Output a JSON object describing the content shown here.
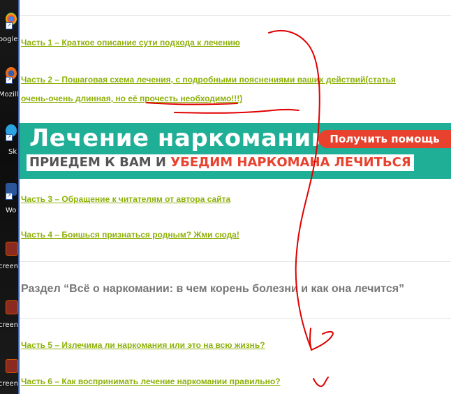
{
  "desktop": {
    "icons": [
      {
        "label": "oogle",
        "icon": "chrome-icon",
        "color": "#e8b40a"
      },
      {
        "label": "Mozilla",
        "icon": "firefox-icon",
        "color": "#e66a1a"
      },
      {
        "label": "Sk",
        "icon": "skype-icon",
        "color": "#2aa3e0"
      },
      {
        "label": "Wo",
        "icon": "word-icon",
        "color": "#2b579a"
      },
      {
        "label": "creen",
        "icon": "screenshot-file-icon",
        "color": "#c0392b"
      },
      {
        "label": "creen",
        "icon": "screenshot-file-icon",
        "color": "#c0392b"
      },
      {
        "label": "creen",
        "icon": "screenshot-file-icon",
        "color": "#c0392b"
      }
    ]
  },
  "links": {
    "part1": "Часть 1 – Краткое описание сути подхода к лечению",
    "part2_line1": "Часть 2 – Пошаговая схема лечения, с подробными пояснениями ваших действий(статья",
    "part2_line2": "очень-очень длинная, но её прочесть необходимо!!!)",
    "part3": "Часть 3 – Обращение к читателям от автора сайта",
    "part4": "Часть 4 – Боишься признаться родным? Жми сюда!",
    "part5": "Часть 5 – Излечима ли наркомания или это на всю жизнь?",
    "part6": "Часть 6 – Как воспринимать лечение наркомании правильно?"
  },
  "banner": {
    "title": "Лечение наркомании",
    "button": "Получить помощь",
    "sub_dark": "ПРИЕДЕМ К ВАМ И ",
    "sub_red": "УБЕДИМ НАРКОМАНА ЛЕЧИТЬСЯ"
  },
  "section": {
    "heading": "Раздел “Всё о наркомании: в чем корень болезни и как она лечится”"
  },
  "colors": {
    "link": "#8db10a",
    "banner_bg": "#1fae96",
    "accent_red": "#e8422e",
    "annotation": "#e00000"
  }
}
